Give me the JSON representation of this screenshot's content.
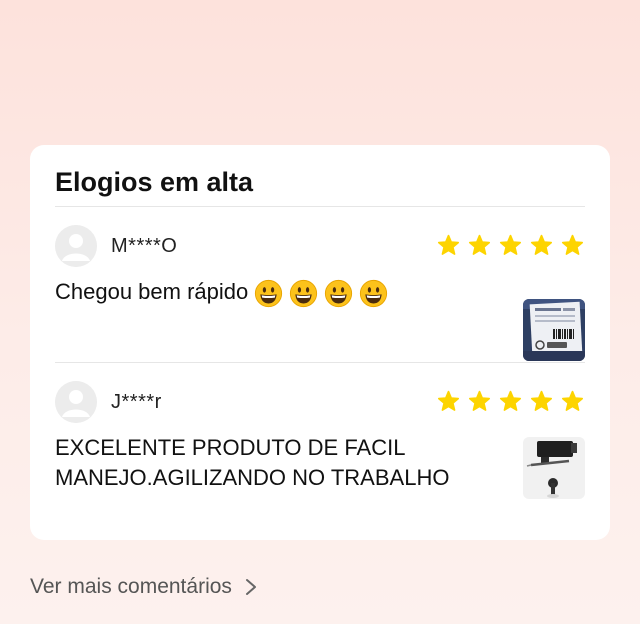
{
  "section": {
    "title": "Elogios em alta"
  },
  "reviews": [
    {
      "username": "M****O",
      "rating": 5,
      "text": "Chegou bem rápido",
      "emoji_count": 4,
      "emoji_icon": "grinning-face-emoji",
      "thumbnail_icon": "shipping-package-photo"
    },
    {
      "username": "J****r",
      "rating": 5,
      "text": "EXCELENTE PRODUTO DE FACIL MANEJO.AGILIZANDO NO TRABALHO",
      "emoji_count": 0,
      "thumbnail_icon": "product-hardware-photo"
    }
  ],
  "footer": {
    "more_label": "Ver mais comentários"
  },
  "colors": {
    "star": "#fdd400",
    "background_top": "#fde2dc",
    "card": "#ffffff"
  }
}
